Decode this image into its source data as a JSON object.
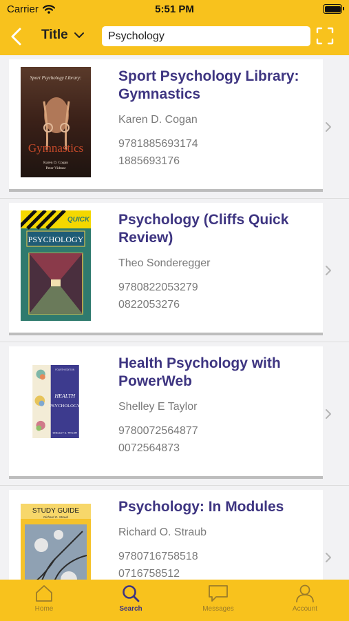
{
  "status_bar": {
    "carrier": "Carrier",
    "time": "5:51 PM"
  },
  "nav": {
    "search_mode": "Title",
    "search_value": "Psychology"
  },
  "books": [
    {
      "title": "Sport Psychology Library: Gymnastics",
      "author": "Karen D. Cogan",
      "isbn13": "9781885693174",
      "isbn10": "1885693176"
    },
    {
      "title": "Psychology (Cliffs Quick Review)",
      "author": "Theo Sonderegger",
      "isbn13": "9780822053279",
      "isbn10": "0822053276"
    },
    {
      "title": "Health Psychology with PowerWeb",
      "author": "Shelley E Taylor",
      "isbn13": "9780072564877",
      "isbn10": "0072564873"
    },
    {
      "title": "Psychology: In Modules",
      "author": "Richard O. Straub",
      "isbn13": "9780716758518",
      "isbn10": "0716758512"
    }
  ],
  "covers": {
    "c1": {
      "line1": "Sport Psychology Library:",
      "big": "Gymnastics",
      "by1": "Karen D. Cogan",
      "by2": "Peter Vidmar"
    },
    "c2": {
      "badge": "QUICK",
      "big": "PSYCHOLOGY"
    },
    "c3": {
      "edition": "FOURTH EDITION",
      "big1": "HEALTH",
      "big2": "PSYCHOLOGY",
      "by": "SHELLEY E. TAYLOR"
    },
    "c4": {
      "top": "STUDY GUIDE",
      "by": "Richard O. Straub"
    }
  },
  "tabs": [
    {
      "label": "Home",
      "icon": "home-icon"
    },
    {
      "label": "Search",
      "icon": "search-icon"
    },
    {
      "label": "Messages",
      "icon": "messages-icon"
    },
    {
      "label": "Account",
      "icon": "account-icon"
    }
  ],
  "colors": {
    "accent": "#f8c21d",
    "title": "#3e3581",
    "text_muted": "#7a7a7a",
    "tab_inactive": "#9a7b2a"
  }
}
